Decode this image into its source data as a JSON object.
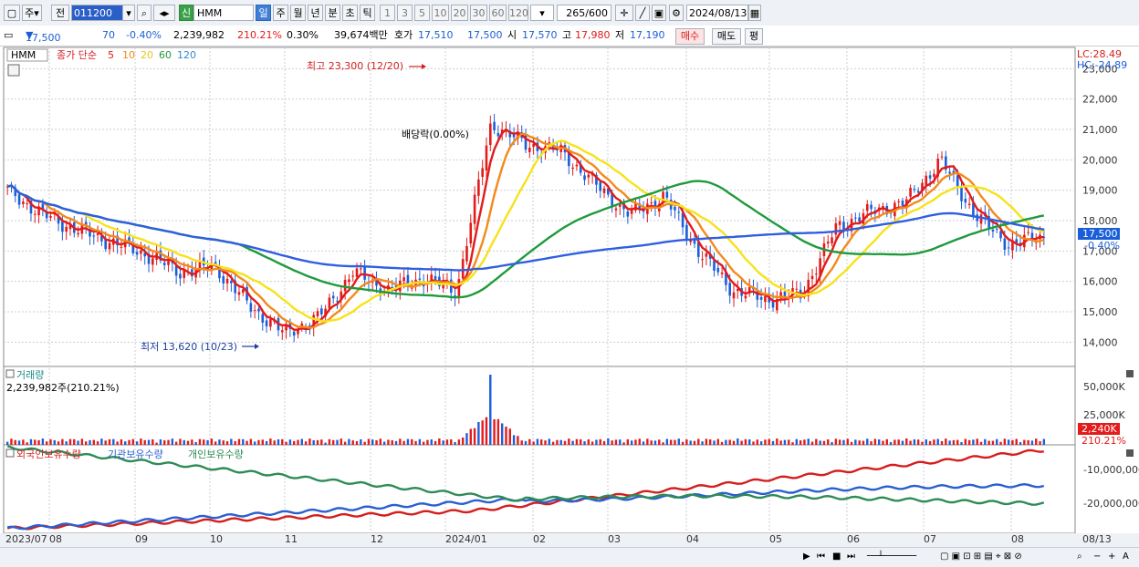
{
  "toolbar": {
    "market": "주",
    "prev_label": "전",
    "code": "011200",
    "new_badge": "신",
    "stock_name": "HMM",
    "periods": [
      "일",
      "주",
      "월",
      "년",
      "분",
      "초",
      "틱"
    ],
    "active_period": "일",
    "intervals": [
      "1",
      "3",
      "5",
      "10",
      "20",
      "30",
      "60",
      "120"
    ],
    "count": "265",
    "count_max": "/600",
    "date": "2024/08/13"
  },
  "quote": {
    "price": "17,500",
    "change": "70",
    "change_pct": "-0.40%",
    "volume": "2,239,982",
    "volume_ratio": "210.21%",
    "turnover_pct": "0.30%",
    "amount": "39,674백만",
    "ask_label": "호가",
    "ask": "17,510",
    "bid": "17,500",
    "open_label": "시",
    "open": "17,570",
    "high_label": "고",
    "high": "17,980",
    "low_label": "저",
    "low": "17,190",
    "buy_button": "매수",
    "sell_button": "매도",
    "eval_button": "평"
  },
  "legend": {
    "stock": "HMM",
    "ma_label": "종가 단순",
    "ma_periods": [
      {
        "label": "5",
        "color": "#e21b1b"
      },
      {
        "label": "10",
        "color": "#f28a1b"
      },
      {
        "label": "20",
        "color": "#f7e21a"
      },
      {
        "label": "60",
        "color": "#1f9a3c"
      },
      {
        "label": "120",
        "color": "#2f8bd8"
      }
    ]
  },
  "annotations": {
    "max_label": "최고 23,300 (12/20)",
    "min_label": "최저 13,620 (10/23)",
    "dividend_label": "배당락(0.00%)",
    "lc": "LC:28.49",
    "hc": "HC:-24.89",
    "last_price_tag": "17,500",
    "last_change_tag": "-0.40%"
  },
  "volume_panel": {
    "title": "거래량",
    "value": "2,239,982주(210.21%)",
    "last_tag": "2,240K",
    "last_pct": "210.21%",
    "y_ticks": [
      "50,000K",
      "25,000K"
    ]
  },
  "holdings_panel": {
    "titles": [
      {
        "label": "외국인보유수량",
        "color": "#d41e1e"
      },
      {
        "label": "기관보유수량",
        "color": "#2a5fcf"
      },
      {
        "label": "개인보유수량",
        "color": "#2e8b57"
      }
    ],
    "y_ticks": [
      "-10,000,000",
      "-20,000,000"
    ]
  },
  "x_axis_labels": [
    "2023/07",
    "08",
    "09",
    "10",
    "11",
    "12",
    "2024/01",
    "02",
    "03",
    "04",
    "05",
    "06",
    "07",
    "08",
    "08/13"
  ],
  "colors": {
    "up": "#e21b1b",
    "down": "#1b5fd8",
    "ma5": "#e21b1b",
    "ma10": "#f28a1b",
    "ma20": "#f7e21a",
    "ma60": "#1f9a3c",
    "ma120": "#2f5fe0"
  },
  "chart_data": [
    {
      "type": "candlestick",
      "title": "HMM",
      "y_ticks": [
        14000,
        15000,
        16000,
        17000,
        18000,
        19000,
        20000,
        21000,
        22000,
        23000
      ],
      "ylim": [
        13200,
        23700
      ],
      "close_anchors": [
        {
          "x": "2023/07",
          "y": 19000
        },
        {
          "x": "07 mid",
          "y": 18200
        },
        {
          "x": "08",
          "y": 17700
        },
        {
          "x": "08 mid",
          "y": 17300
        },
        {
          "x": "09",
          "y": 16900
        },
        {
          "x": "09 mid",
          "y": 16300
        },
        {
          "x": "10",
          "y": 16500
        },
        {
          "x": "10 mid",
          "y": 15200
        },
        {
          "x": "10/23",
          "y": 14300
        },
        {
          "x": "11",
          "y": 14800
        },
        {
          "x": "11 mid",
          "y": 16300
        },
        {
          "x": "11 late",
          "y": 15700
        },
        {
          "x": "12",
          "y": 16100
        },
        {
          "x": "12 mid",
          "y": 15700
        },
        {
          "x": "12/20",
          "y": 21200
        },
        {
          "x": "2024/01",
          "y": 20500
        },
        {
          "x": "01 mid",
          "y": 20300
        },
        {
          "x": "02",
          "y": 19200
        },
        {
          "x": "02 mid",
          "y": 18200
        },
        {
          "x": "03",
          "y": 18800
        },
        {
          "x": "03 mid",
          "y": 17000
        },
        {
          "x": "04",
          "y": 15700
        },
        {
          "x": "04 mid",
          "y": 15400
        },
        {
          "x": "05",
          "y": 15600
        },
        {
          "x": "05 mid",
          "y": 17800
        },
        {
          "x": "06",
          "y": 18300
        },
        {
          "x": "06 mid",
          "y": 18600
        },
        {
          "x": "07",
          "y": 20000
        },
        {
          "x": "07 mid",
          "y": 18200
        },
        {
          "x": "08",
          "y": 17200
        },
        {
          "x": "08/13",
          "y": 17500
        }
      ]
    },
    {
      "type": "bar",
      "title": "거래량",
      "ylim": [
        0,
        60000
      ],
      "unit": "K",
      "last_value": 2240,
      "peak": {
        "x": "12/20",
        "y": 55000
      }
    },
    {
      "type": "line",
      "series": [
        {
          "name": "외국인보유수량",
          "values_start_end": [
            -23000000,
            -7000000
          ]
        },
        {
          "name": "기관보유수량",
          "values_start_end": [
            -23000000,
            -13000000
          ]
        },
        {
          "name": "개인보유수량",
          "values_start_end": [
            -6500000,
            -22000000
          ]
        }
      ],
      "ylim": [
        -24000000,
        -6000000
      ]
    }
  ],
  "footer": {
    "zoom_buttons": [
      "−",
      "+",
      "A"
    ]
  }
}
